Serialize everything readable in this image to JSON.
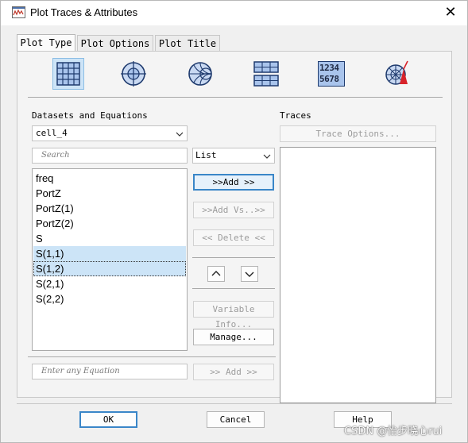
{
  "window": {
    "title": "Plot Traces & Attributes",
    "close_glyph": "✕"
  },
  "tabs": [
    {
      "label": "Plot Type",
      "active": true
    },
    {
      "label": "Plot Options",
      "active": false
    },
    {
      "label": "Plot Title",
      "active": false
    }
  ],
  "plot_types": [
    {
      "icon": "rectangular-plot-icon",
      "selected": true
    },
    {
      "icon": "polar-plot-icon",
      "selected": false
    },
    {
      "icon": "smith-chart-icon",
      "selected": false
    },
    {
      "icon": "stacked-plot-icon",
      "selected": false
    },
    {
      "icon": "list-plot-icon",
      "text_top": "1234",
      "text_bottom": "5678",
      "selected": false
    },
    {
      "icon": "antenna-plot-icon",
      "selected": false
    }
  ],
  "datasets": {
    "heading": "Datasets and Equations",
    "selected_dataset": "cell_4",
    "search_placeholder": "Search",
    "view_mode": "List",
    "variables": [
      {
        "name": "freq",
        "state": "normal"
      },
      {
        "name": "PortZ",
        "state": "normal"
      },
      {
        "name": "PortZ(1)",
        "state": "normal"
      },
      {
        "name": "PortZ(2)",
        "state": "normal"
      },
      {
        "name": "S",
        "state": "normal"
      },
      {
        "name": "S(1,1)",
        "state": "selected"
      },
      {
        "name": "S(1,2)",
        "state": "selected-focused"
      },
      {
        "name": "S(2,1)",
        "state": "normal"
      },
      {
        "name": "S(2,2)",
        "state": "normal"
      }
    ],
    "equation_placeholder": "Enter any Equation"
  },
  "middle_buttons": {
    "add": ">>Add >>",
    "add_vs": ">>Add Vs..>>",
    "delete": "<< Delete <<",
    "move_up": "^",
    "move_down": "v",
    "variable_info": "Variable Info...",
    "manage": "Manage...",
    "add_equation": ">> Add >>"
  },
  "traces": {
    "heading": "Traces",
    "trace_options": "Trace Options..."
  },
  "footer": {
    "ok": "OK",
    "cancel": "Cancel",
    "help": "Help"
  },
  "watermark": "CSDN @怡步晓心rui",
  "colors": {
    "selection": "#cce4f7",
    "default_button_border": "#3a86c8",
    "antenna_red": "#d8232a",
    "icon_navy": "#1f3b6e"
  }
}
